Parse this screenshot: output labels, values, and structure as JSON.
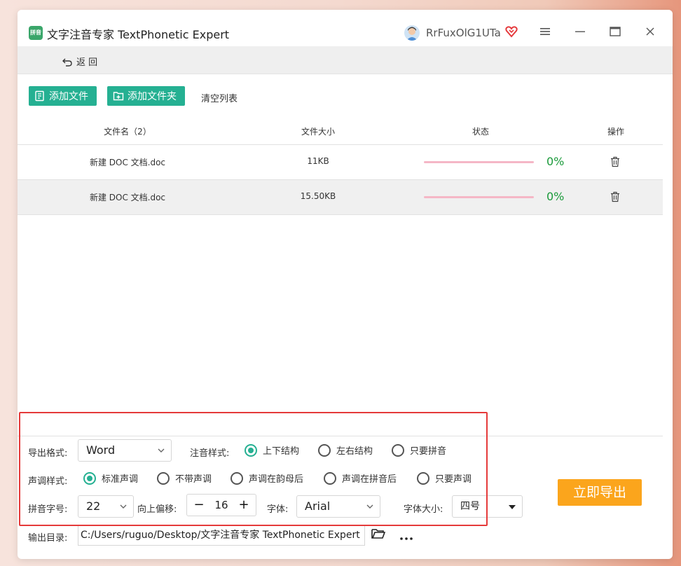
{
  "app": {
    "logo_text": "拼音",
    "title": "文字注音专家 TextPhonetic Expert",
    "username": "RrFuxOlG1UTa"
  },
  "nav": {
    "back_label": "返 回"
  },
  "actions": {
    "add_file": "添加文件",
    "add_folder": "添加文件夹",
    "clear_list": "清空列表"
  },
  "table": {
    "headers": [
      "文件名（2）",
      "文件大小",
      "状态",
      "操作"
    ],
    "rows": [
      {
        "name": "新建 DOC 文档.doc",
        "size": "11KB",
        "progress": "0%"
      },
      {
        "name": "新建 DOC 文档.doc",
        "size": "15.50KB",
        "progress": "0%"
      }
    ]
  },
  "settings": {
    "export_format_label": "导出格式:",
    "export_format_value": "Word",
    "phonetic_style_label": "注音样式:",
    "phonetic_style_options": [
      "上下结构",
      "左右结构",
      "只要拼音"
    ],
    "phonetic_style_selected": 0,
    "tone_style_label": "声调样式:",
    "tone_style_options": [
      "标准声调",
      "不带声调",
      "声调在韵母后",
      "声调在拼音后",
      "只要声调"
    ],
    "tone_style_selected": 0,
    "pinyin_size_label": "拼音字号:",
    "pinyin_size_value": "22",
    "offset_label": "向上偏移:",
    "offset_value": "16",
    "font_label": "字体:",
    "font_value": "Arial",
    "font_size_label": "字体大小:",
    "font_size_value": "四号",
    "output_dir_label": "输出目录:",
    "output_dir_value": "C:/Users/ruguo/Desktop/文字注音专家 TextPhonetic Expert",
    "export_button": "立即导出"
  },
  "colors": {
    "accent_green": "#25b092",
    "export_orange": "#fba51c",
    "progress_pink": "#f5b7c6",
    "percent_green": "#1a9a3a",
    "highlight_red": "#e53a3a"
  }
}
